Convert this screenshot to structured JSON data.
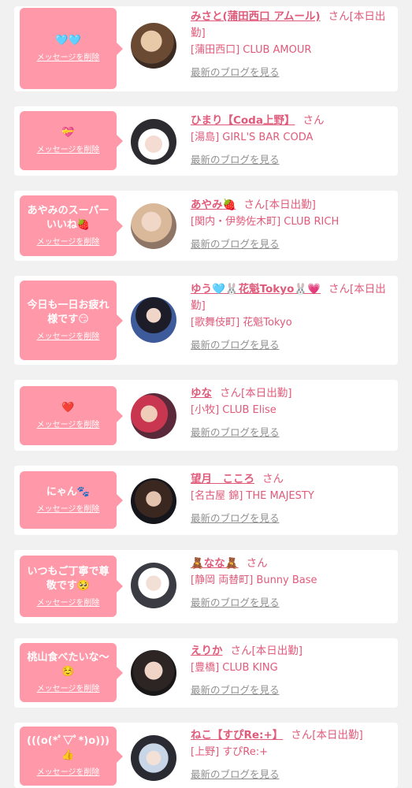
{
  "delete_label": "メッセージを削除",
  "blog_label": "最新のブログを見る",
  "honorific": "さん",
  "cards": [
    {
      "message": "🩵🩵",
      "name": "みさと(蒲田西口 アムール)",
      "status": "[本日出勤]",
      "shop": "[蒲田西口] CLUB AMOUR"
    },
    {
      "message": "💝",
      "name": "ひまり【Coda上野】",
      "status": "",
      "shop": "[湯島] GIRL'S BAR CODA"
    },
    {
      "message": "あやみのスーパーいいね🍓",
      "name": "あやみ🍓",
      "status": "[本日出勤]",
      "shop": "[関内・伊勢佐木町] CLUB RICH"
    },
    {
      "message": "今日も一日お疲れ様です😏",
      "name": "ゆう🩵🐰花魁Tokyo🐰💗",
      "status": "[本日出勤]",
      "shop": "[歌舞伎町] 花魁Tokyo"
    },
    {
      "message": "❤️",
      "name": "ゆな",
      "status": "[本日出勤]",
      "shop": "[小牧] CLUB Elise"
    },
    {
      "message": "にゃん🐾",
      "name": "望月　こころ",
      "status": "",
      "shop": "[名古屋 錦] THE MAJESTY"
    },
    {
      "message": "いつもご丁寧で尊敬です🥺",
      "name": "🧸なな🧸",
      "status": "",
      "shop": "[静岡 両替町] Bunny Base"
    },
    {
      "message": "桃山食べたいな〜☺️",
      "name": "えりか",
      "status": "[本日出勤]",
      "shop": "[豊橋] CLUB KING"
    },
    {
      "message": "(((o(*ﾟ▽ﾟ*)o)))👍",
      "name": "ねこ【すぴRe:+】",
      "status": "[本日出勤]",
      "shop": "[上野] すぴRe:+"
    }
  ]
}
